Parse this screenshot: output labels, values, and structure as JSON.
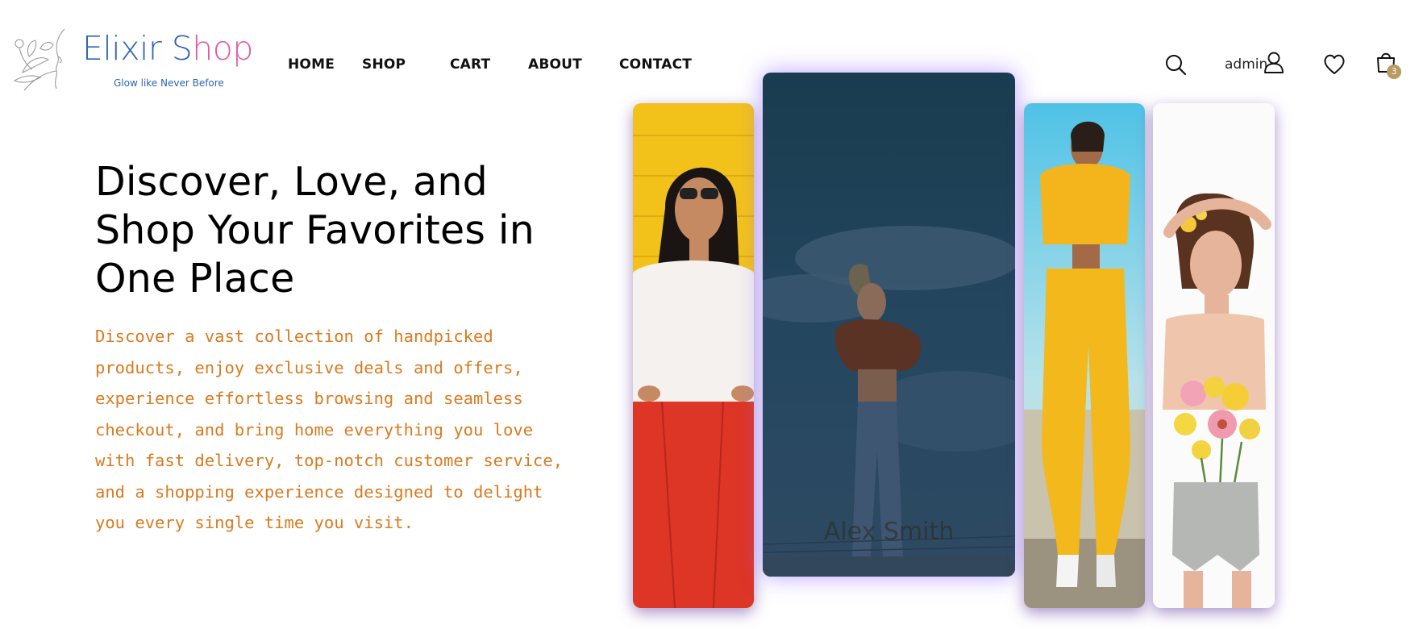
{
  "brand": {
    "name_part1": "Elixir S",
    "name_part2": "hop",
    "tagline": "Glow like Never Before"
  },
  "nav": {
    "items": [
      "HOME",
      "SHOP",
      "CART",
      "ABOUT",
      "CONTACT"
    ]
  },
  "header": {
    "icons": [
      "search-icon",
      "user-icon",
      "heart-icon",
      "shopping-bag-icon"
    ],
    "admin_label": "admin",
    "cart_count": "3"
  },
  "hero": {
    "title": "Discover, Love, and Shop Your Favorites in One Place",
    "description": "Discover a vast collection of handpicked products, enjoy exclusive deals and offers, experience effortless browsing and seamless checkout, and bring home everything you love with fast delivery, top-notch customer service, and a shopping experience designed to delight you every single time you visit."
  },
  "gallery": {
    "featured_caption": "Alex Smith"
  },
  "colors": {
    "brand_blue": "#2f63b8",
    "brand_pink": "#e25aa8",
    "description_orange": "#d97a1e",
    "badge_gold": "#b89a62"
  }
}
